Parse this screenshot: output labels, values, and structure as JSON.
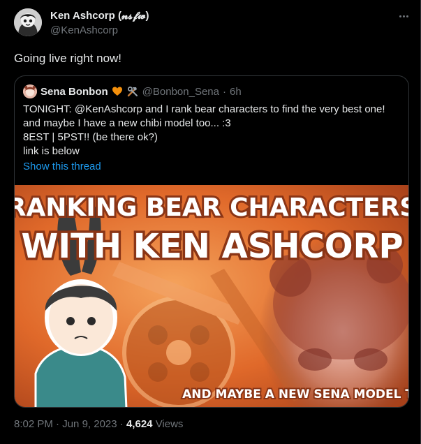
{
  "tweet": {
    "author_name": "Ken Ashcorp (𝓷𝓼𝓯𝔀)",
    "author_handle": "@KenAshcorp",
    "text": "Going live right now!"
  },
  "quote": {
    "author_name": "Sena Bonbon",
    "author_handle": "@Bonbon_Sena",
    "separator": "·",
    "time": "6h",
    "lines": [
      "TONIGHT: @KenAshcorp and I rank bear characters to find the very best one!",
      "and maybe I have a new chibi model too... :3",
      "8EST | 5PST!! (be there ok?)",
      "link is below"
    ],
    "show_thread_label": "Show this thread",
    "media": {
      "title_line1": "RANKING BEAR CHARACTERS",
      "title_line2": "WITH KEN ASHCORP",
      "caption": "AND MAYBE A NEW SENA MODEL TOO"
    }
  },
  "footer": {
    "time": "8:02 PM",
    "separator": "·",
    "date": "Jun 9, 2023",
    "views_count": "4,624",
    "views_label": "Views"
  },
  "colors": {
    "background": "#000000",
    "text": "#e7e9ea",
    "muted": "#71767b",
    "link": "#1d9bf0",
    "border": "#2f3336",
    "media_orange": "#e8762b"
  },
  "icons": [
    "more-icon",
    "orange-heart-icon",
    "tools-icon"
  ]
}
